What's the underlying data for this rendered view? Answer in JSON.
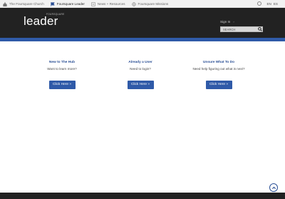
{
  "topbar": {
    "items": [
      {
        "label": "The Foursquare Church",
        "icon": "church-icon"
      },
      {
        "label": "Foursquare Leader",
        "icon": "flag-icon"
      },
      {
        "label": "News + Resources",
        "icon": "news-icon"
      },
      {
        "label": "Foursquare Missions",
        "icon": "globe-icon"
      }
    ],
    "languages": [
      "EN",
      "ES"
    ]
  },
  "header": {
    "logo_small": "FOURSQUARE",
    "logo_main": "leader",
    "signin_label": "Sign In",
    "search_placeholder": "SEARCH"
  },
  "columns": [
    {
      "title": "New to The Hub",
      "subtitle": "Want to learn more?",
      "button": "Click Here »"
    },
    {
      "title": "Already a User",
      "subtitle": "Need to login?",
      "button": "Click Here »"
    },
    {
      "title": "Unsure What To Do",
      "subtitle": "Need help figuring out what is next?",
      "button": "Click Here »"
    }
  ],
  "colors": {
    "accent": "#2f5aa8",
    "header_bg": "#222222",
    "title": "#2a4f95"
  }
}
